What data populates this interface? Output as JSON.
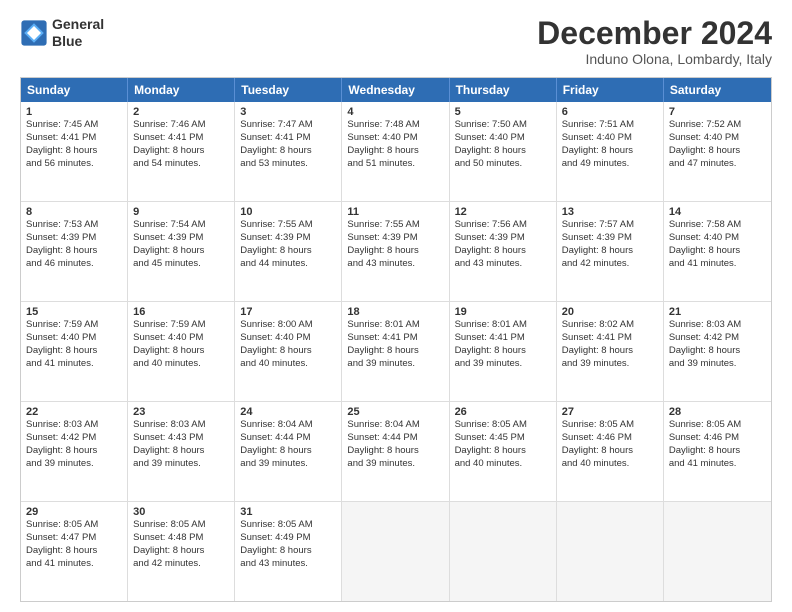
{
  "header": {
    "logo_line1": "General",
    "logo_line2": "Blue",
    "month": "December 2024",
    "location": "Induno Olona, Lombardy, Italy"
  },
  "days_of_week": [
    "Sunday",
    "Monday",
    "Tuesday",
    "Wednesday",
    "Thursday",
    "Friday",
    "Saturday"
  ],
  "rows": [
    [
      {
        "day": "1",
        "lines": [
          "Sunrise: 7:45 AM",
          "Sunset: 4:41 PM",
          "Daylight: 8 hours",
          "and 56 minutes."
        ]
      },
      {
        "day": "2",
        "lines": [
          "Sunrise: 7:46 AM",
          "Sunset: 4:41 PM",
          "Daylight: 8 hours",
          "and 54 minutes."
        ]
      },
      {
        "day": "3",
        "lines": [
          "Sunrise: 7:47 AM",
          "Sunset: 4:41 PM",
          "Daylight: 8 hours",
          "and 53 minutes."
        ]
      },
      {
        "day": "4",
        "lines": [
          "Sunrise: 7:48 AM",
          "Sunset: 4:40 PM",
          "Daylight: 8 hours",
          "and 51 minutes."
        ]
      },
      {
        "day": "5",
        "lines": [
          "Sunrise: 7:50 AM",
          "Sunset: 4:40 PM",
          "Daylight: 8 hours",
          "and 50 minutes."
        ]
      },
      {
        "day": "6",
        "lines": [
          "Sunrise: 7:51 AM",
          "Sunset: 4:40 PM",
          "Daylight: 8 hours",
          "and 49 minutes."
        ]
      },
      {
        "day": "7",
        "lines": [
          "Sunrise: 7:52 AM",
          "Sunset: 4:40 PM",
          "Daylight: 8 hours",
          "and 47 minutes."
        ]
      }
    ],
    [
      {
        "day": "8",
        "lines": [
          "Sunrise: 7:53 AM",
          "Sunset: 4:39 PM",
          "Daylight: 8 hours",
          "and 46 minutes."
        ]
      },
      {
        "day": "9",
        "lines": [
          "Sunrise: 7:54 AM",
          "Sunset: 4:39 PM",
          "Daylight: 8 hours",
          "and 45 minutes."
        ]
      },
      {
        "day": "10",
        "lines": [
          "Sunrise: 7:55 AM",
          "Sunset: 4:39 PM",
          "Daylight: 8 hours",
          "and 44 minutes."
        ]
      },
      {
        "day": "11",
        "lines": [
          "Sunrise: 7:55 AM",
          "Sunset: 4:39 PM",
          "Daylight: 8 hours",
          "and 43 minutes."
        ]
      },
      {
        "day": "12",
        "lines": [
          "Sunrise: 7:56 AM",
          "Sunset: 4:39 PM",
          "Daylight: 8 hours",
          "and 43 minutes."
        ]
      },
      {
        "day": "13",
        "lines": [
          "Sunrise: 7:57 AM",
          "Sunset: 4:39 PM",
          "Daylight: 8 hours",
          "and 42 minutes."
        ]
      },
      {
        "day": "14",
        "lines": [
          "Sunrise: 7:58 AM",
          "Sunset: 4:40 PM",
          "Daylight: 8 hours",
          "and 41 minutes."
        ]
      }
    ],
    [
      {
        "day": "15",
        "lines": [
          "Sunrise: 7:59 AM",
          "Sunset: 4:40 PM",
          "Daylight: 8 hours",
          "and 41 minutes."
        ]
      },
      {
        "day": "16",
        "lines": [
          "Sunrise: 7:59 AM",
          "Sunset: 4:40 PM",
          "Daylight: 8 hours",
          "and 40 minutes."
        ]
      },
      {
        "day": "17",
        "lines": [
          "Sunrise: 8:00 AM",
          "Sunset: 4:40 PM",
          "Daylight: 8 hours",
          "and 40 minutes."
        ]
      },
      {
        "day": "18",
        "lines": [
          "Sunrise: 8:01 AM",
          "Sunset: 4:41 PM",
          "Daylight: 8 hours",
          "and 39 minutes."
        ]
      },
      {
        "day": "19",
        "lines": [
          "Sunrise: 8:01 AM",
          "Sunset: 4:41 PM",
          "Daylight: 8 hours",
          "and 39 minutes."
        ]
      },
      {
        "day": "20",
        "lines": [
          "Sunrise: 8:02 AM",
          "Sunset: 4:41 PM",
          "Daylight: 8 hours",
          "and 39 minutes."
        ]
      },
      {
        "day": "21",
        "lines": [
          "Sunrise: 8:03 AM",
          "Sunset: 4:42 PM",
          "Daylight: 8 hours",
          "and 39 minutes."
        ]
      }
    ],
    [
      {
        "day": "22",
        "lines": [
          "Sunrise: 8:03 AM",
          "Sunset: 4:42 PM",
          "Daylight: 8 hours",
          "and 39 minutes."
        ]
      },
      {
        "day": "23",
        "lines": [
          "Sunrise: 8:03 AM",
          "Sunset: 4:43 PM",
          "Daylight: 8 hours",
          "and 39 minutes."
        ]
      },
      {
        "day": "24",
        "lines": [
          "Sunrise: 8:04 AM",
          "Sunset: 4:44 PM",
          "Daylight: 8 hours",
          "and 39 minutes."
        ]
      },
      {
        "day": "25",
        "lines": [
          "Sunrise: 8:04 AM",
          "Sunset: 4:44 PM",
          "Daylight: 8 hours",
          "and 39 minutes."
        ]
      },
      {
        "day": "26",
        "lines": [
          "Sunrise: 8:05 AM",
          "Sunset: 4:45 PM",
          "Daylight: 8 hours",
          "and 40 minutes."
        ]
      },
      {
        "day": "27",
        "lines": [
          "Sunrise: 8:05 AM",
          "Sunset: 4:46 PM",
          "Daylight: 8 hours",
          "and 40 minutes."
        ]
      },
      {
        "day": "28",
        "lines": [
          "Sunrise: 8:05 AM",
          "Sunset: 4:46 PM",
          "Daylight: 8 hours",
          "and 41 minutes."
        ]
      }
    ],
    [
      {
        "day": "29",
        "lines": [
          "Sunrise: 8:05 AM",
          "Sunset: 4:47 PM",
          "Daylight: 8 hours",
          "and 41 minutes."
        ]
      },
      {
        "day": "30",
        "lines": [
          "Sunrise: 8:05 AM",
          "Sunset: 4:48 PM",
          "Daylight: 8 hours",
          "and 42 minutes."
        ]
      },
      {
        "day": "31",
        "lines": [
          "Sunrise: 8:05 AM",
          "Sunset: 4:49 PM",
          "Daylight: 8 hours",
          "and 43 minutes."
        ]
      },
      {
        "day": "",
        "lines": []
      },
      {
        "day": "",
        "lines": []
      },
      {
        "day": "",
        "lines": []
      },
      {
        "day": "",
        "lines": []
      }
    ]
  ]
}
